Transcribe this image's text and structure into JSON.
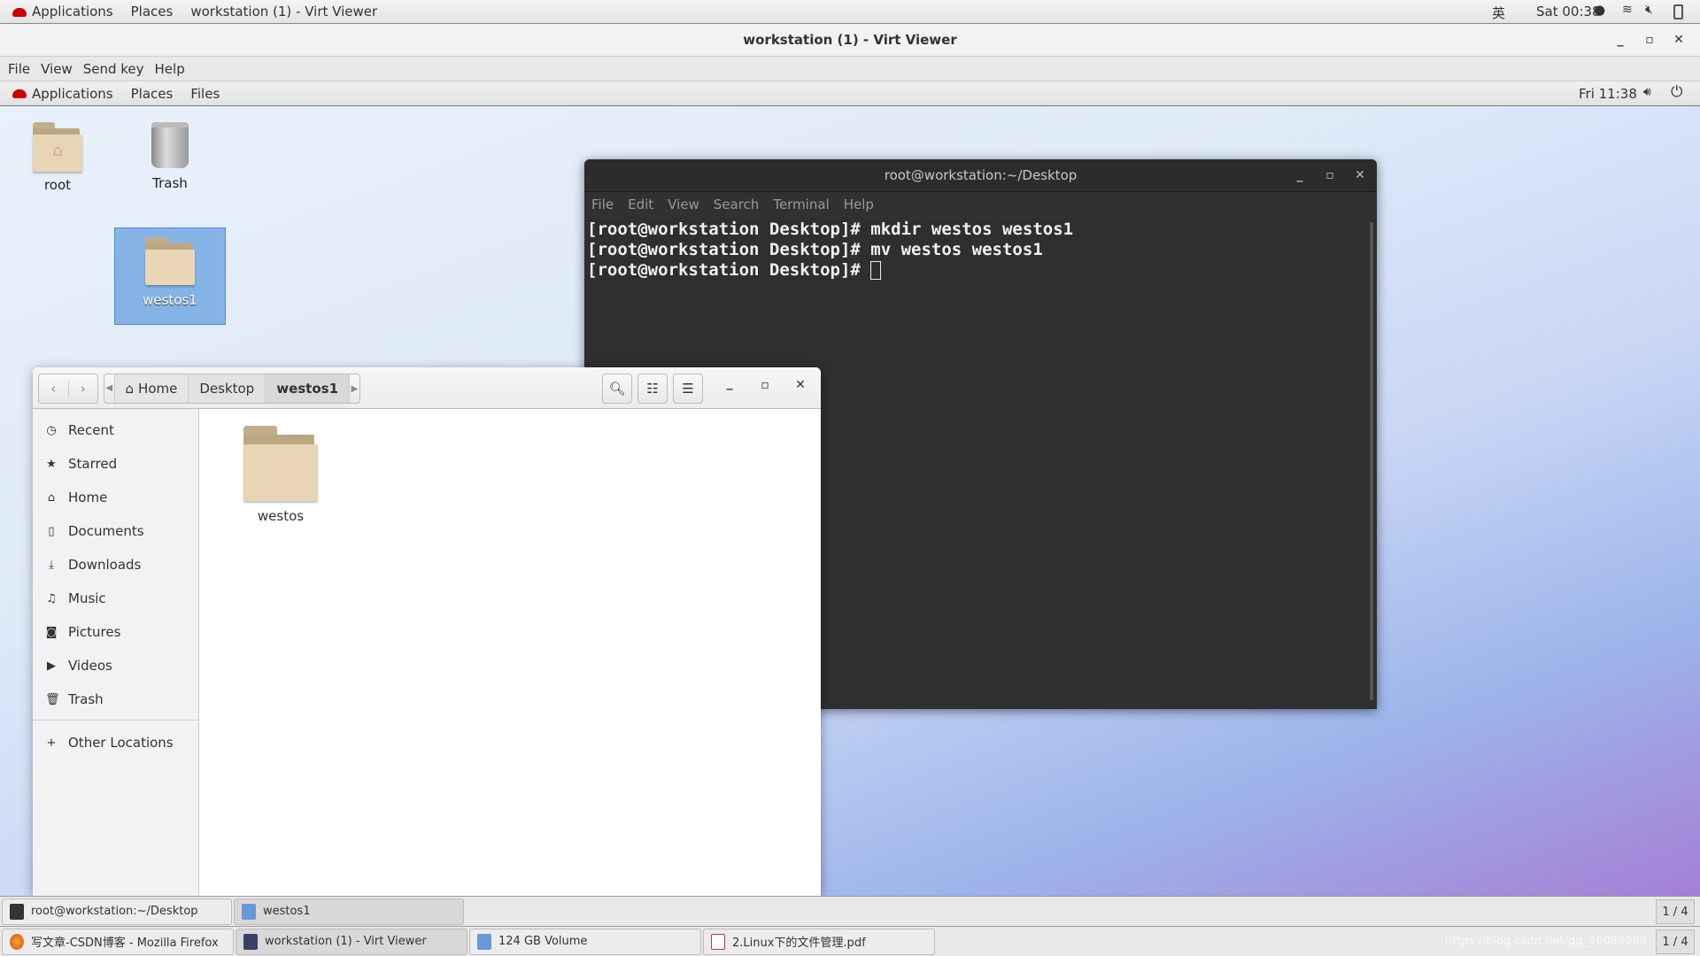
{
  "host_topbar": {
    "applications": "Applications",
    "places": "Places",
    "window": "workstation (1) - Virt Viewer",
    "input_method": "英",
    "clock": "Sat 00:38"
  },
  "viewer": {
    "title": "workstation (1) - Virt Viewer",
    "menu": [
      "File",
      "View",
      "Send key",
      "Help"
    ]
  },
  "guest_topbar": {
    "applications": "Applications",
    "places": "Places",
    "files": "Files",
    "clock": "Fri 11:38"
  },
  "desktop_icons": [
    {
      "label": "root"
    },
    {
      "label": "Trash"
    },
    {
      "label": "westos1"
    }
  ],
  "terminal": {
    "title": "root@workstation:~/Desktop",
    "menu": [
      "File",
      "Edit",
      "View",
      "Search",
      "Terminal",
      "Help"
    ],
    "lines": [
      "[root@workstation Desktop]# mkdir westos westos1",
      "[root@workstation Desktop]# mv westos westos1",
      "[root@workstation Desktop]# "
    ]
  },
  "files": {
    "breadcrumb": [
      "Home",
      "Desktop",
      "westos1"
    ],
    "sidebar": [
      "Recent",
      "Starred",
      "Home",
      "Documents",
      "Downloads",
      "Music",
      "Pictures",
      "Videos",
      "Trash"
    ],
    "other_locations": "Other Locations",
    "items": [
      {
        "name": "westos"
      }
    ]
  },
  "guest_taskbar": {
    "tasks": [
      "root@workstation:~/Desktop",
      "westos1"
    ],
    "pager": "1 / 4"
  },
  "host_taskbar": {
    "tasks": [
      "写文章-CSDN博客 - Mozilla Firefox",
      "workstation (1) - Virt Viewer",
      "124 GB Volume",
      "2.Linux下的文件管理.pdf"
    ],
    "pager": "1 / 4",
    "watermark": "https://blog.csdn.net/qq_46089299"
  }
}
